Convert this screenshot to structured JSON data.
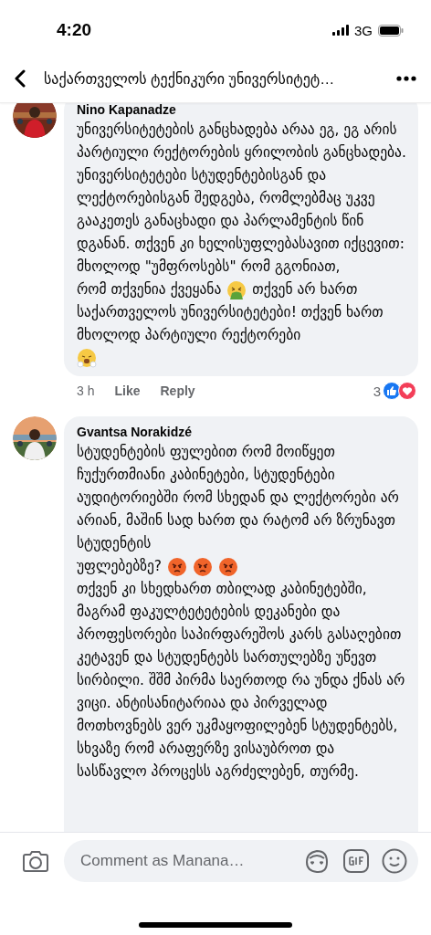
{
  "status_bar": {
    "time": "4:20",
    "network": "3G"
  },
  "header": {
    "title": "საქართველოს ტექნიკური უნივერსიტეტ…"
  },
  "comments": [
    {
      "author": "Nino Kapanadze",
      "blocks": [
        [
          {
            "kind": "text",
            "text": "უნივერსიტეტების განცხადება არაა ეგ, ეგ არის პარტიული რექტორების ყრილობის განცხადება. უნივერსიტეტები სტუდენტებისგან და ლექტორებისგან შედგება, რომლებმაც უკვე გააკეთეს განაცხადი და პარლამენტის წინ დგანან. თქვენ კი ხელისუფლებასავით იქცევით: მხოლოდ \"უმფროსებს\" რომ გგონიათ,"
          }
        ],
        [
          {
            "kind": "text",
            "text": "რომ თქვენია ქვეყანა"
          },
          {
            "kind": "vomit"
          },
          {
            "kind": "text",
            "text": "თქვენ არ ხართ"
          }
        ],
        [
          {
            "kind": "text",
            "text": "საქართველოს უნივერსიტეტები! თქვენ ხართ მხოლოდ პარტიული რექტორები"
          }
        ],
        [
          {
            "kind": "huff"
          }
        ]
      ],
      "time": "3 h",
      "actions": [
        "Like",
        "Reply"
      ],
      "reaction_count": "3"
    },
    {
      "author": "Gvantsa Norakidzé",
      "blocks": [
        [
          {
            "kind": "text",
            "text": "სტუდენტების ფულებით რომ მოიწყეთ ჩუქურთმიანი კაბინეტები, სტუდენტები აუდიტორიებში რომ სხედან და ლექტორები არ არიან, მაშინ სად ხართ და რატომ არ ზრუნავთ სტუდენტის"
          }
        ],
        [
          {
            "kind": "text",
            "text": "უფლებებზე?"
          },
          {
            "kind": "angry"
          },
          {
            "kind": "angry"
          },
          {
            "kind": "angry"
          }
        ],
        [
          {
            "kind": "text",
            "text": "თქვენ კი სხედხართ თბილად კაბინეტებში, მაგრამ ფაკულტეტეტების დეკანები და პროფესორები საპირფარეშოს კარს გასაღებით კეტავენ და სტუდენტებს სართულებზე უწევთ სირბილი. შშმ პირმა საერთოდ რა უნდა ქნას არ ვიცი. ანტისანიტარიაა და პირველად მოთხოვნებს ვერ უკმაყოფილებენ სტუდენტებს, სხვაზე რომ არაფერზე ვისაუბროთ და სასწავლო პროცესს აგრძელებენ, თურმე."
          }
        ]
      ]
    }
  ],
  "composer": {
    "placeholder": "Comment as Manana…"
  }
}
